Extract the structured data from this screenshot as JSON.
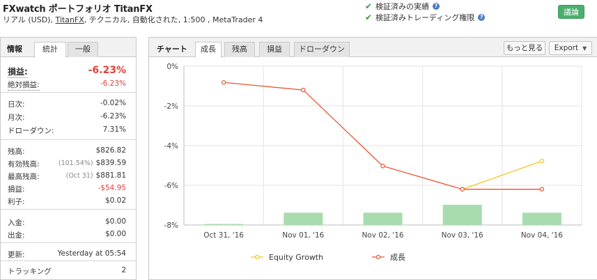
{
  "header": {
    "title": "FXwatch ポートフォリオ TitanFX",
    "sub_prefix": "リアル (USD), ",
    "broker_link": "TitanFX",
    "sub_suffix": ", テクニカル, 自動化された, 1:500 , MetaTrader 4",
    "verify_track": "検証済みの実績",
    "verify_trading": "検証済みトレーディング権限",
    "discuss_button": "議論"
  },
  "left_panel": {
    "label": "情報",
    "tabs": [
      "統計",
      "一般"
    ],
    "rows": [
      {
        "key": "損益:",
        "value": "-6.23%",
        "red": true,
        "big": true,
        "underline": true
      },
      {
        "key": "絶対損益:",
        "value": "-6.23%",
        "red": true,
        "underline": true
      },
      {
        "key": "日次:",
        "value": "-0.02%"
      },
      {
        "key": "月次:",
        "value": "-6.23%"
      },
      {
        "key": "ドローダウン:",
        "value": "7.31%"
      },
      {
        "key": "残高:",
        "value": "$826.82"
      },
      {
        "key": "有効残高:",
        "note": "(101.54%)",
        "value": "$839.59"
      },
      {
        "key": "最高残高:",
        "note": "(Oct 31)",
        "value": "$881.81"
      },
      {
        "key": "損益:",
        "value": "-$54.95",
        "red": true
      },
      {
        "key": "利子:",
        "value": "$0.02"
      },
      {
        "key": "入金:",
        "value": "$0.00"
      },
      {
        "key": "出金:",
        "value": "$0.00"
      },
      {
        "key": "更新:",
        "value": "Yesterday at 05:54"
      },
      {
        "key": "トラッキング",
        "value": "2"
      }
    ]
  },
  "right_panel": {
    "label": "チャート",
    "tabs": [
      "成長",
      "残高",
      "損益",
      "ドローダウン"
    ],
    "more_button": "もっと見る",
    "export_button": "Export"
  },
  "chart_data": {
    "type": "line",
    "categories": [
      "Oct 31, '16",
      "Nov 01, '16",
      "Nov 02, '16",
      "Nov 03, '16",
      "Nov 04, '16"
    ],
    "y_tick_labels": [
      "0%",
      "-2%",
      "-4%",
      "-6%",
      "-8%"
    ],
    "y_ticks": [
      0,
      -2,
      -4,
      -6,
      -8
    ],
    "ylim": [
      -8,
      0
    ],
    "series": [
      {
        "name": "Equity Growth",
        "color": "#f6c520",
        "values": [
          null,
          null,
          null,
          -6.2,
          -4.78
        ]
      },
      {
        "name": "成長",
        "color": "#e8542e",
        "values": [
          -0.82,
          -1.2,
          -5.03,
          -6.2,
          -6.2
        ]
      }
    ],
    "bars": {
      "color": "#a8dcae",
      "values": [
        -0.05,
        -0.62,
        -0.62,
        -1.02,
        -0.62
      ]
    },
    "grid": true,
    "legend": "bottom"
  },
  "colors": {
    "accent_green": "#4cae6c",
    "red": "#e0403a"
  }
}
